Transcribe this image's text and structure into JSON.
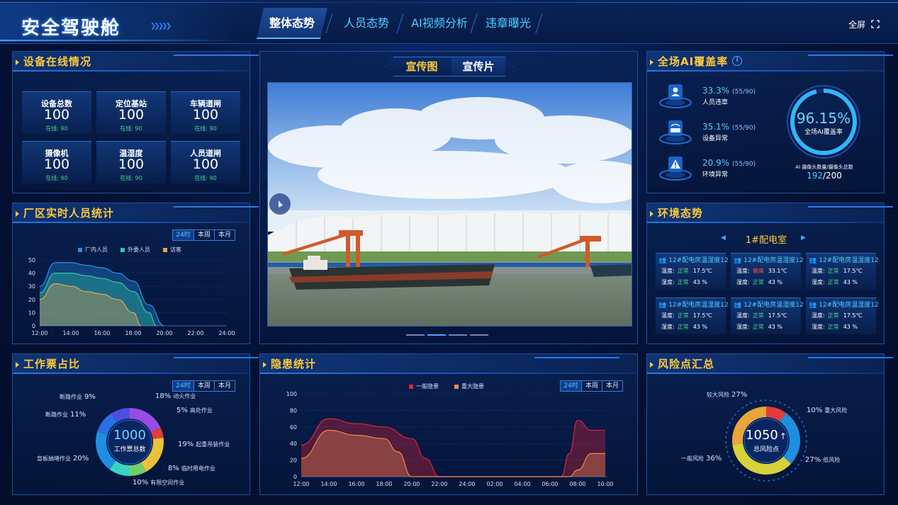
{
  "header": {
    "title": "安全驾驶舱",
    "tabs": [
      {
        "label": "整体态势",
        "active": true
      },
      {
        "label": "人员态势",
        "active": false
      },
      {
        "label": "AI视频分析",
        "active": false
      },
      {
        "label": "违章曝光",
        "active": false
      }
    ],
    "fullscreen": "全屏"
  },
  "device": {
    "title": "设备在线情况",
    "cards": [
      {
        "name": "设备总数",
        "value": "100",
        "online": "在线: 90"
      },
      {
        "name": "定位基站",
        "value": "100",
        "online": "在线: 90"
      },
      {
        "name": "车辆道闸",
        "value": "100",
        "online": "在线: 90"
      },
      {
        "name": "摄像机",
        "value": "100",
        "online": "在线: 90"
      },
      {
        "name": "温湿度",
        "value": "100",
        "online": "在线: 90"
      },
      {
        "name": "人员道闸",
        "value": "100",
        "online": "在线: 90"
      }
    ]
  },
  "media": {
    "tab1": "宣传图",
    "tab2": "宣传片"
  },
  "ai": {
    "title": "全场AI覆盖率",
    "rows": [
      {
        "pct": "33.3%",
        "frac": "(55/90)",
        "label": "人员违章"
      },
      {
        "pct": "35.1%",
        "frac": "(55/90)",
        "label": "设备异常"
      },
      {
        "pct": "20.9%",
        "frac": "(55/90)",
        "label": "环境异常"
      }
    ],
    "ring_value": "96.15%",
    "ring_label": "全场AI覆盖率",
    "ring_fraction": 0.9615,
    "footer_label": "AI 摄像头数量/摄像头总数",
    "footer_num": "192",
    "footer_den": "/200"
  },
  "personnel": {
    "title": "厂区实时人员统计",
    "segments": [
      "24时",
      "本周",
      "本月"
    ],
    "colors": {
      "厂内人员": "#2a8fe6",
      "外委人员": "#2fc7a2",
      "访客": "#e8a24a"
    }
  },
  "env": {
    "title": "环境态势",
    "room": "1#配电室",
    "temp_label": "温度:",
    "hum_label": "湿度:",
    "cards": [
      {
        "title": "12#配电房温湿度12",
        "temp_state": "正常",
        "temp_bad": false,
        "temp": "17.5℃",
        "hum_state": "正常",
        "hum": "43 %"
      },
      {
        "title": "12#配电房温湿度12",
        "temp_state": "偏高",
        "temp_bad": true,
        "temp": "33.1℃",
        "hum_state": "正常",
        "hum": "43 %"
      },
      {
        "title": "12#配电房温湿度12",
        "temp_state": "正常",
        "temp_bad": false,
        "temp": "17.5℃",
        "hum_state": "正常",
        "hum": "43 %"
      },
      {
        "title": "12#配电房温湿度12",
        "temp_state": "正常",
        "temp_bad": false,
        "temp": "17.5℃",
        "hum_state": "正常",
        "hum": "43 %"
      },
      {
        "title": "12#配电房温湿度12",
        "temp_state": "正常",
        "temp_bad": false,
        "temp": "17.5℃",
        "hum_state": "正常",
        "hum": "43 %"
      },
      {
        "title": "12#配电房温湿度12",
        "temp_state": "正常",
        "temp_bad": false,
        "temp": "17.5℃",
        "hum_state": "正常",
        "hum": "43 %"
      }
    ]
  },
  "ticket": {
    "title": "工作票占比",
    "segments": [
      "24时",
      "本周",
      "本月"
    ],
    "center_value": "1000",
    "center_label": "工作票总数"
  },
  "hazard": {
    "title": "隐患统计",
    "segments": [
      "24时",
      "本周",
      "本月"
    ]
  },
  "risk": {
    "title": "风险点汇总",
    "center_value": "1050",
    "center_label": "总风险点"
  },
  "chart_data": [
    {
      "type": "area",
      "id": "personnel",
      "x": [
        "12:00",
        "14:00",
        "16:00",
        "18:00",
        "20:00",
        "22:00",
        "24:00"
      ],
      "ylim": [
        0,
        50
      ],
      "yticks": [
        0,
        10,
        20,
        30,
        40,
        50
      ],
      "series": [
        {
          "name": "厂内人员",
          "color": "#2a8fe6",
          "points": [
            [
              12,
              30
            ],
            [
              13,
              48
            ],
            [
              14,
              48
            ],
            [
              15,
              46
            ],
            [
              16,
              44
            ],
            [
              17,
              40
            ],
            [
              18,
              34
            ],
            [
              19,
              16
            ],
            [
              20,
              0
            ]
          ]
        },
        {
          "name": "外委人员",
          "color": "#2fc7a2",
          "points": [
            [
              12,
              25
            ],
            [
              13,
              40
            ],
            [
              14,
              40
            ],
            [
              15,
              38
            ],
            [
              16,
              36
            ],
            [
              17,
              33
            ],
            [
              18,
              26
            ],
            [
              19,
              10
            ],
            [
              19.5,
              0
            ]
          ]
        },
        {
          "name": "访客",
          "color": "#e8a24a",
          "points": [
            [
              12,
              20
            ],
            [
              13,
              32
            ],
            [
              14,
              30
            ],
            [
              15,
              26
            ],
            [
              16,
              24
            ],
            [
              17,
              20
            ],
            [
              18,
              10
            ],
            [
              18.5,
              0
            ]
          ]
        }
      ]
    },
    {
      "type": "area",
      "id": "hazard",
      "x": [
        "12:00",
        "14:00",
        "16:00",
        "18:00",
        "20:00",
        "22:00",
        "24:00",
        "02:00",
        "04:00",
        "06:00",
        "08:00",
        "10:00"
      ],
      "ylim": [
        0,
        100
      ],
      "yticks": [
        0,
        20,
        40,
        60,
        80,
        100
      ],
      "series": [
        {
          "name": "一般隐患",
          "color": "#e0223a",
          "points": [
            [
              0,
              38
            ],
            [
              1,
              70
            ],
            [
              2,
              64
            ],
            [
              3,
              60
            ],
            [
              4,
              46
            ],
            [
              4.5,
              22
            ],
            [
              5,
              0
            ],
            [
              9.4,
              0
            ],
            [
              9.7,
              28
            ],
            [
              10,
              68
            ],
            [
              10.5,
              56
            ],
            [
              11,
              56
            ]
          ]
        },
        {
          "name": "重大隐患",
          "color": "#f08a4a",
          "points": [
            [
              0,
              22
            ],
            [
              1,
              56
            ],
            [
              2,
              50
            ],
            [
              3,
              46
            ],
            [
              3.5,
              30
            ],
            [
              4,
              0
            ],
            [
              9.7,
              0
            ],
            [
              10,
              8
            ],
            [
              10.5,
              28
            ],
            [
              11,
              28
            ]
          ]
        }
      ]
    },
    {
      "type": "pie",
      "id": "ticket",
      "slices": [
        {
          "label": "动火作业",
          "value": 18,
          "color": "#9a4be6"
        },
        {
          "label": "高处作业",
          "value": 5,
          "color": "#e23c3c"
        },
        {
          "label": "起重吊装作业",
          "value": 19,
          "color": "#e8c23a"
        },
        {
          "label": "临时用电作业",
          "value": 8,
          "color": "#6fd06a"
        },
        {
          "label": "有限空间作业",
          "value": 10,
          "color": "#38d4c2"
        },
        {
          "label": "盲板抽堵作业",
          "value": 20,
          "color": "#1e8fe0"
        },
        {
          "label": "断路作业",
          "value": 11,
          "color": "#2a6fe8"
        },
        {
          "label": "断路作业",
          "value": 9,
          "color": "#4a4fe0"
        }
      ]
    },
    {
      "type": "pie",
      "id": "risk",
      "slices": [
        {
          "label": "重大风险",
          "value": 10,
          "color": "#e23c3c"
        },
        {
          "label": "低风险",
          "value": 27,
          "color": "#1e8fe0"
        },
        {
          "label": "一般风险",
          "value": 36,
          "color": "#d6d23a"
        },
        {
          "label": "较大风险",
          "value": 27,
          "color": "#e8a63a"
        }
      ]
    }
  ]
}
